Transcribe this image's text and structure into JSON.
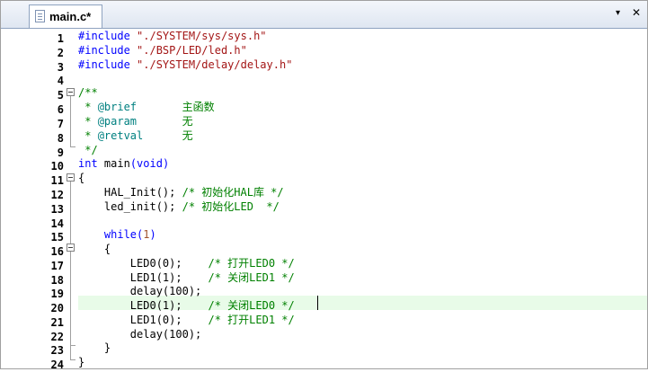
{
  "tab": {
    "label": "main.c*",
    "menu_arrow": "▾",
    "close": "✕"
  },
  "lines": [
    {
      "n": "1"
    },
    {
      "n": "2"
    },
    {
      "n": "3"
    },
    {
      "n": "4"
    },
    {
      "n": "5"
    },
    {
      "n": "6"
    },
    {
      "n": "7"
    },
    {
      "n": "8"
    },
    {
      "n": "9"
    },
    {
      "n": "10"
    },
    {
      "n": "11"
    },
    {
      "n": "12"
    },
    {
      "n": "13"
    },
    {
      "n": "14"
    },
    {
      "n": "15"
    },
    {
      "n": "16"
    },
    {
      "n": "17"
    },
    {
      "n": "18"
    },
    {
      "n": "19"
    },
    {
      "n": "20"
    },
    {
      "n": "21"
    },
    {
      "n": "22"
    },
    {
      "n": "23"
    },
    {
      "n": "24"
    }
  ],
  "code": {
    "l1": {
      "directive": "#include",
      "path": " \"./SYSTEM/sys/sys.h\""
    },
    "l2": {
      "directive": "#include",
      "path": " \"./BSP/LED/led.h\""
    },
    "l3": {
      "directive": "#include",
      "path": " \"./SYSTEM/delay/delay.h\""
    },
    "l5": "/**",
    "l6": {
      "prefix": " * ",
      "tag": "@brief",
      "text": "       主函数"
    },
    "l7": {
      "prefix": " * ",
      "tag": "@param",
      "text": "       无"
    },
    "l8": {
      "prefix": " * ",
      "tag": "@retval",
      "text": "      无"
    },
    "l9": " */",
    "l10": {
      "type": "int",
      "name": " main",
      "open": "(",
      "void": "void",
      "close": ")"
    },
    "l11": "{",
    "l12": {
      "call": "    HAL_Init(); ",
      "comment": "/* 初始化HAL库 */"
    },
    "l13": {
      "call": "    led_init(); ",
      "comment": "/* 初始化LED  */"
    },
    "l15": {
      "indent": "    ",
      "kw": "while",
      "open": "(",
      "arg": "1",
      "close": ")"
    },
    "l16": "    {",
    "l17": {
      "call": "        LED0(0);    ",
      "comment": "/* 打开LED0 */"
    },
    "l18": {
      "call": "        LED1(1);    ",
      "comment": "/* 关闭LED1 */"
    },
    "l19": "        delay(100);",
    "l20": {
      "call": "        LED0(1);    ",
      "comment": "/* 关闭LED0 */"
    },
    "l21": {
      "call": "        LED1(0);    ",
      "comment": "/* 打开LED1 */"
    },
    "l22": "        delay(100);",
    "l23": "    }",
    "l24": "}"
  }
}
